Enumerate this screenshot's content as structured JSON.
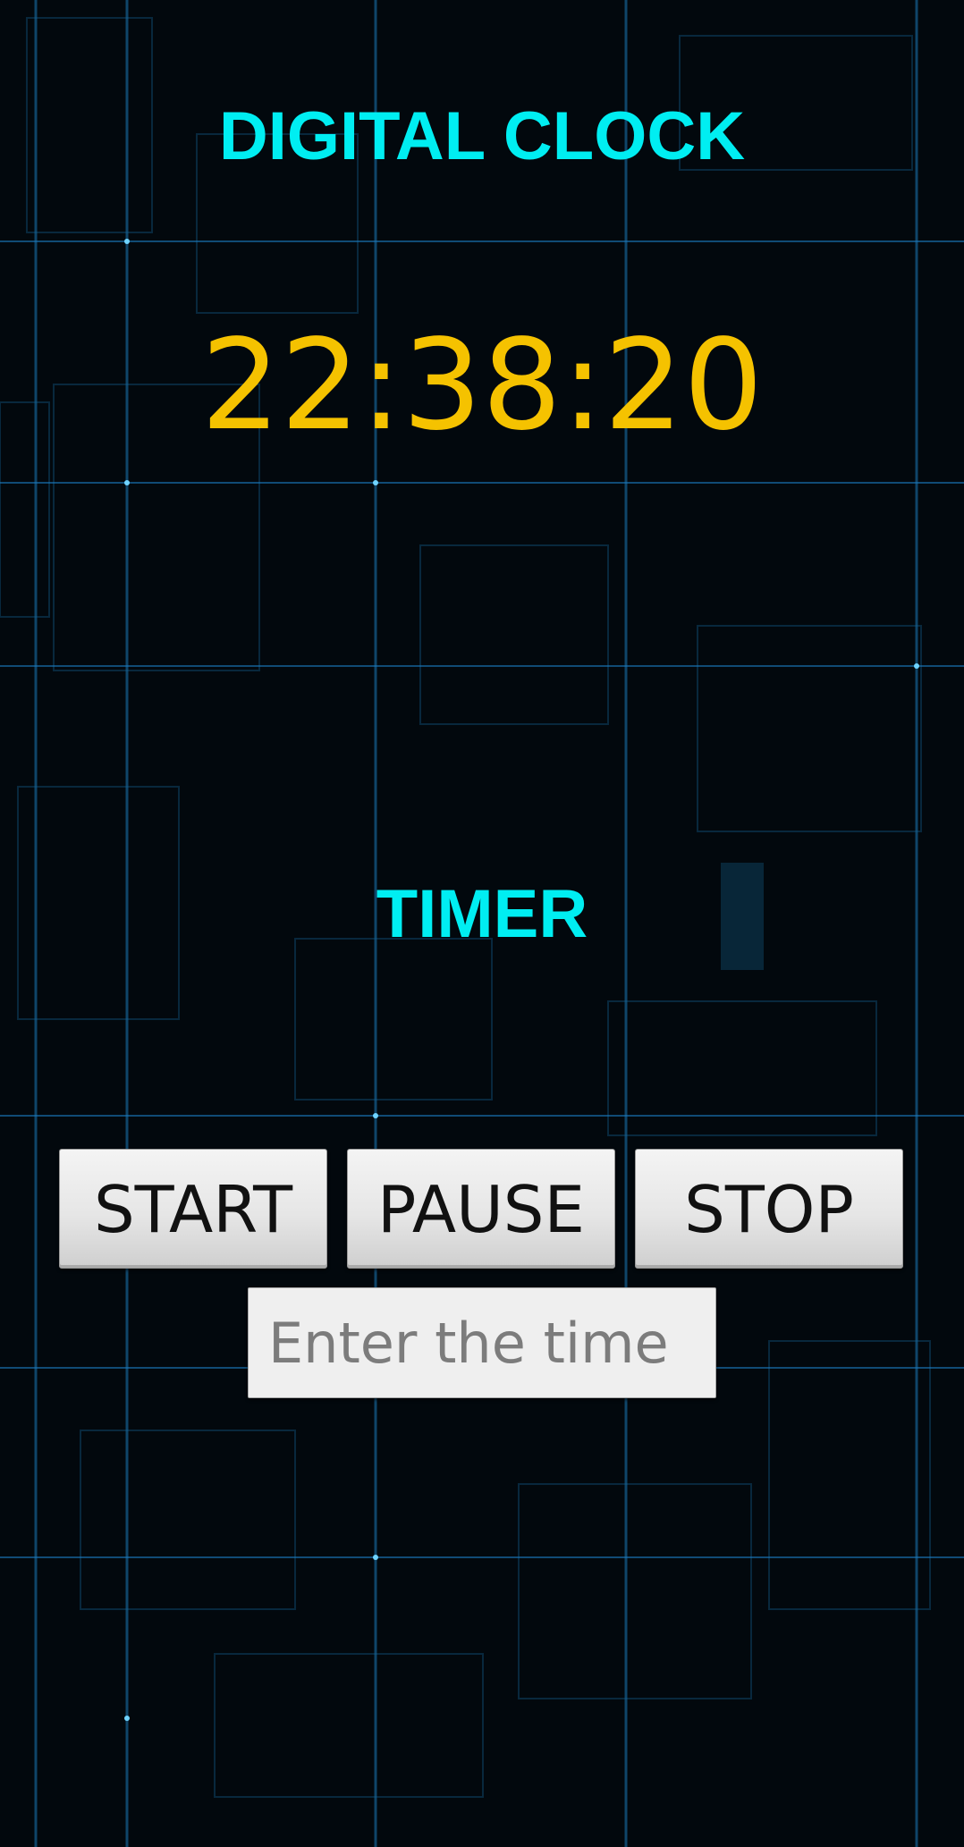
{
  "clock": {
    "title": "DIGITAL CLOCK",
    "time": "22:38:20"
  },
  "timer": {
    "title": "TIMER",
    "buttons": {
      "start": "START",
      "pause": "PAUSE",
      "stop": "STOP"
    },
    "input": {
      "value": "",
      "placeholder": "Enter the time"
    }
  },
  "colors": {
    "title_cyan": "#00eef2",
    "clock_yellow": "#f5c200",
    "background": "#02080d",
    "grid_line": "#1d8ad6"
  }
}
